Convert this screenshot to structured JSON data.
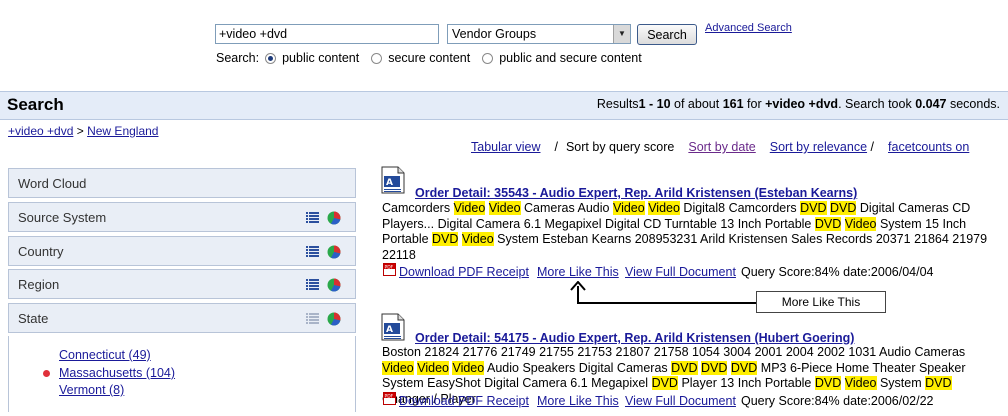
{
  "search": {
    "query": "+video +dvd",
    "vendor_select": "Vendor Groups",
    "button": "Search",
    "advanced": "Advanced Search",
    "scope_label": "Search:",
    "scopes": [
      "public content",
      "secure content",
      "public and secure content"
    ],
    "selected_scope": 0
  },
  "band": {
    "title": "Search",
    "results_prefix": "Results",
    "range": "1 - 10",
    "of_about": "of about",
    "total": "161",
    "for": "for",
    "query_bold": "+video +dvd",
    "took": ". Search took",
    "time": "0.047",
    "seconds": "seconds."
  },
  "breadcrumb": {
    "query": "+video +dvd",
    "sep": ">",
    "region": "New England"
  },
  "sort": {
    "tabular": "Tabular view",
    "slash": "/",
    "by_query": "Sort by query score",
    "by_date": "Sort by date",
    "by_relevance": "Sort by relevance",
    "facetcounts": "facetcounts on"
  },
  "facets": [
    "Word Cloud",
    "Source System",
    "Country",
    "Region",
    "State"
  ],
  "state_values": [
    {
      "label": "Connecticut (49)",
      "selected": false
    },
    {
      "label": "Massachusetts (104)",
      "selected": true
    },
    {
      "label": "Vermont (8)",
      "selected": false
    }
  ],
  "results": [
    {
      "title": "Order Detail: 35543 - Audio Expert, Rep. Arild Kristensen (Esteban Kearns)",
      "snippet": [
        [
          "Camcorders ",
          false
        ],
        [
          "Video",
          true
        ],
        [
          " ",
          false
        ],
        [
          "Video",
          true
        ],
        [
          " Cameras Audio ",
          false
        ],
        [
          "Video",
          true
        ],
        [
          " ",
          false
        ],
        [
          "Video",
          true
        ],
        [
          " Digital8 Camcorders ",
          false
        ],
        [
          "DVD",
          true
        ],
        [
          " ",
          false
        ],
        [
          "DVD",
          true
        ],
        [
          " Digital Cameras CD Players... Digital Camera 6.1 Megapixel Digital CD Turntable 13 Inch Portable ",
          false
        ],
        [
          "DVD",
          true
        ],
        [
          " ",
          false
        ],
        [
          "Video",
          true
        ],
        [
          " System 15 Inch Portable ",
          false
        ],
        [
          "DVD",
          true
        ],
        [
          " ",
          false
        ],
        [
          "Video",
          true
        ],
        [
          " System Esteban Kearns 208953231 Arild Kristensen Sales Records 20371 21864 21979 22118",
          false
        ]
      ],
      "pdf": "Download PDF Receipt",
      "more": "More Like This",
      "full": "View Full Document",
      "score": "Query Score:84% date:2006/04/04"
    },
    {
      "title": "Order Detail: 54175 - Audio Expert, Rep. Arild Kristensen (Hubert Goering)",
      "snippet": [
        [
          "Boston 21824 21776 21749 21755 21753 21807 21758 1054 3004 2001 2004 2002 1031 Audio Cameras ",
          false
        ],
        [
          "Video",
          true
        ],
        [
          " ",
          false
        ],
        [
          "Video",
          true
        ],
        [
          " ",
          false
        ],
        [
          "Video",
          true
        ],
        [
          " Audio Speakers Digital Cameras ",
          false
        ],
        [
          "DVD",
          true
        ],
        [
          " ",
          false
        ],
        [
          "DVD",
          true
        ],
        [
          " ",
          false
        ],
        [
          "DVD",
          true
        ],
        [
          " MP3 6-Piece Home Theater Speaker System EasyShot Digital Camera 6.1 Megapixel ",
          false
        ],
        [
          "DVD",
          true
        ],
        [
          " Player 13 Inch Portable ",
          false
        ],
        [
          "DVD",
          true
        ],
        [
          " ",
          false
        ],
        [
          "Video",
          true
        ],
        [
          " System ",
          false
        ],
        [
          "DVD",
          true
        ],
        [
          " Changer / Player",
          false
        ]
      ],
      "pdf": "Download PDF Receipt",
      "more": "More Like This",
      "full": "View Full Document",
      "score": "Query Score:84% date:2006/02/22"
    }
  ],
  "callout": "More Like This",
  "colors": {
    "band": "#e4ecf8",
    "highlight": "#ffef00",
    "link": "#1a1a99",
    "visited": "#6a2a8a"
  }
}
